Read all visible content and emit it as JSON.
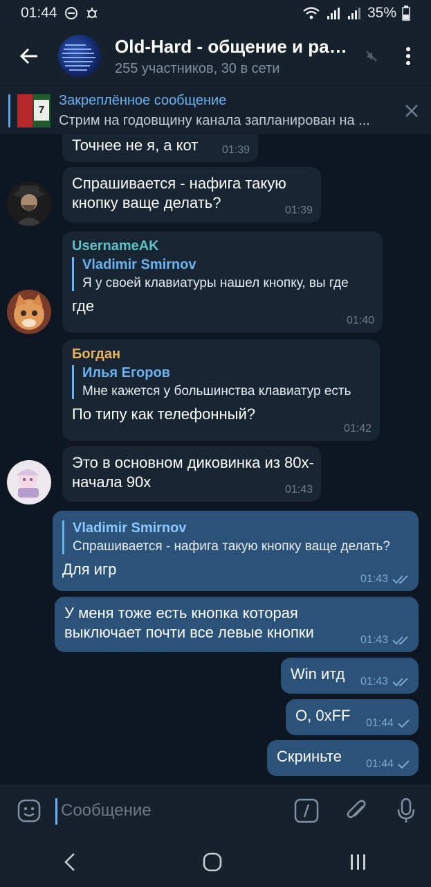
{
  "status_bar": {
    "time": "01:44",
    "battery": "35%"
  },
  "header": {
    "title": "Old-Hard - общение и разговоры",
    "subtitle": "255 участников, 30 в сети"
  },
  "pinned": {
    "title": "Закреплённое сообщение",
    "text": "Стрим на годовщину канала запланирован на ..."
  },
  "messages": [
    {
      "text": "Точнее не я, а кот",
      "time": "01:39"
    },
    {
      "text": "Спрашивается - нафига такую кнопку ваще делать?",
      "time": "01:39"
    },
    {
      "sender": "UsernameAK",
      "sender_color": "#5ec0c7",
      "reply_name": "Vladimir Smirnov",
      "reply_text": "Я у своей клавиатуры нашел кнопку, вы где",
      "text": "где",
      "time": "01:40"
    },
    {
      "sender": "Богдан",
      "sender_color": "#e8b35c",
      "reply_name": "Илья Егоров",
      "reply_text": "Мне кажется у большинства клавиатур есть",
      "text": "По типу как телефонный?",
      "time": "01:42"
    },
    {
      "text": "Это в основном диковинка из 80х-начала 90х",
      "time": "01:43"
    },
    {
      "reply_name": "Vladimir Smirnov",
      "reply_text": "Спрашивается - нафига такую кнопку ваще делать?",
      "text": "Для игр",
      "time": "01:43"
    },
    {
      "text": "У меня тоже есть кнопка которая выключает почти все левые кнопки",
      "time": "01:43"
    },
    {
      "text": "Win итд",
      "time": "01:43"
    },
    {
      "text": "O, 0xFF",
      "time": "01:44"
    },
    {
      "text": "Скриньте",
      "time": "01:44"
    }
  ],
  "input": {
    "placeholder": "Сообщение"
  },
  "colors": {
    "accent": "#6ab2f2",
    "incoming": "#182533",
    "outgoing": "#2b5278",
    "background": "#0e1621"
  },
  "icons": [
    "arrow-left-icon",
    "mute-icon",
    "more-vert-icon",
    "close-icon",
    "emoji-icon",
    "bot-command-icon",
    "paperclip-icon",
    "microphone-icon",
    "double-check-icon",
    "check-icon"
  ]
}
